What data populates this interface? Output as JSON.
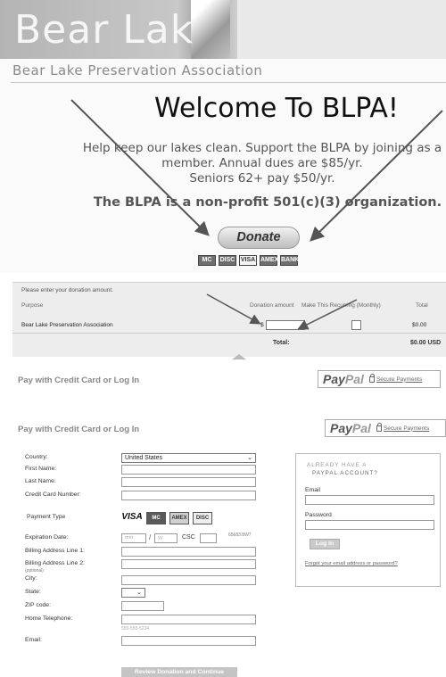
{
  "site": {
    "banner_title": "Bear Lak",
    "subtitle": "Bear Lake Preservation Association",
    "welcome": "Welcome To BLPA!",
    "blurb_line1": "Help keep our lakes clean. Support the BLPA by joining as a",
    "blurb_line2": "member. Annual dues are $85/yr.",
    "blurb_line3": "Seniors 62+ pay $50/yr.",
    "nonprofit": "The BLPA is a non-profit 501(c)(3) organization.",
    "donate_label": "Donate",
    "card_marks": [
      "MC",
      "DISC",
      "VISA",
      "AMEX",
      "BANK"
    ]
  },
  "cart": {
    "prompt": "Please enter your donation amount.",
    "headers": {
      "purpose": "Purpose",
      "donation_amount": "Donation amount",
      "recurring": "Make This Recurring (Monthly)",
      "total": "Total"
    },
    "row": {
      "purpose": "Bear Lake Preservation Association",
      "currency": "$",
      "total": "$0.00"
    },
    "total_label": "Total:",
    "total_value": "$0.00 USD"
  },
  "paypal": {
    "heading": "Pay with Credit Card or Log In",
    "logo_pay": "Pay",
    "logo_pal": "Pal",
    "secure": "Secure Payments"
  },
  "form": {
    "country_label": "Country:",
    "country_value": "United States",
    "first_name": "First Name:",
    "last_name": "Last Name:",
    "card_number": "Credit Card Number:",
    "payment_type": "Payment Type",
    "card_logos": [
      "VISA",
      "MC",
      "AMEX",
      "DISC"
    ],
    "expiration": "Expiration Date:",
    "mm_placeholder": "mm",
    "yy_placeholder": "yy",
    "csc": "CSC",
    "csc_hint": "65683.8W7",
    "billing1": "Billing Address Line 1:",
    "billing2": "Billing Address Line 2:",
    "optional": "(optional)",
    "city": "City:",
    "state": "State:",
    "zip": "ZIP code:",
    "phone": "Home Telephone:",
    "phone_hint": "555-555-5234",
    "email": "Email:",
    "review_button": "Review Donation and Continue"
  },
  "login": {
    "title_line1": "ALREADY HAVE A",
    "title_line2": "PAYPAL ACCOUNT?",
    "email_label": "Email",
    "password_label": "Password",
    "login_button": "Log In",
    "forgot": "Forgot your email address or password?"
  },
  "colors": {
    "arrow": "#555555",
    "panel_bg": "#ededed",
    "banner": "#c8c8c8"
  }
}
